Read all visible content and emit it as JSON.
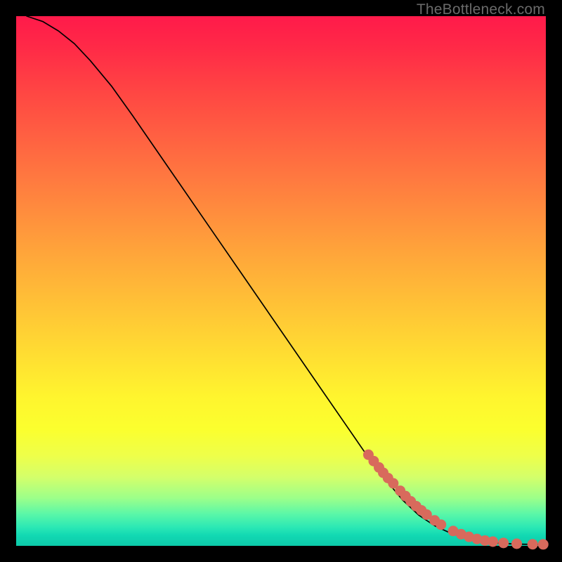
{
  "watermark": "TheBottleneck.com",
  "colors": {
    "marker": "#d86a5c",
    "line": "#000000"
  },
  "chart_data": {
    "type": "line",
    "title": "",
    "xlabel": "",
    "ylabel": "",
    "xlim": [
      0,
      100
    ],
    "ylim": [
      0,
      100
    ],
    "grid": false,
    "legend": false,
    "notes": "Axes unlabeled; values estimated from pixel positions on a 0–100 normalized scale. Curve descends from top-left to near-zero on the right; a cluster of markers sits on the lower-right segment and along the floor.",
    "series": [
      {
        "name": "curve",
        "type": "line",
        "x": [
          2,
          5,
          8,
          11,
          14,
          18,
          22,
          26,
          30,
          34,
          38,
          42,
          46,
          50,
          54,
          58,
          62,
          66,
          70,
          73,
          76,
          79,
          82,
          85,
          88,
          90,
          92,
          94,
          96,
          98,
          100
        ],
        "y": [
          100,
          99,
          97.2,
          94.8,
          91.6,
          86.8,
          81.2,
          75.4,
          69.6,
          63.8,
          58.0,
          52.2,
          46.4,
          40.6,
          34.8,
          29.0,
          23.2,
          17.4,
          12.2,
          8.6,
          5.8,
          3.8,
          2.4,
          1.5,
          0.9,
          0.6,
          0.45,
          0.35,
          0.3,
          0.28,
          0.27
        ]
      },
      {
        "name": "markers",
        "type": "scatter",
        "x": [
          66.5,
          67.5,
          68.5,
          69.3,
          70.2,
          71.2,
          72.5,
          73.5,
          74.5,
          75.5,
          76.5,
          77.5,
          79.0,
          80.2,
          82.5,
          84.0,
          85.5,
          87.0,
          88.5,
          90.0,
          92.0,
          94.5,
          97.5,
          99.5
        ],
        "y": [
          17.2,
          16.0,
          14.8,
          13.8,
          12.8,
          11.8,
          10.4,
          9.4,
          8.4,
          7.5,
          6.7,
          5.9,
          4.8,
          4.0,
          2.8,
          2.2,
          1.7,
          1.3,
          1.0,
          0.8,
          0.55,
          0.4,
          0.3,
          0.28
        ]
      }
    ]
  }
}
